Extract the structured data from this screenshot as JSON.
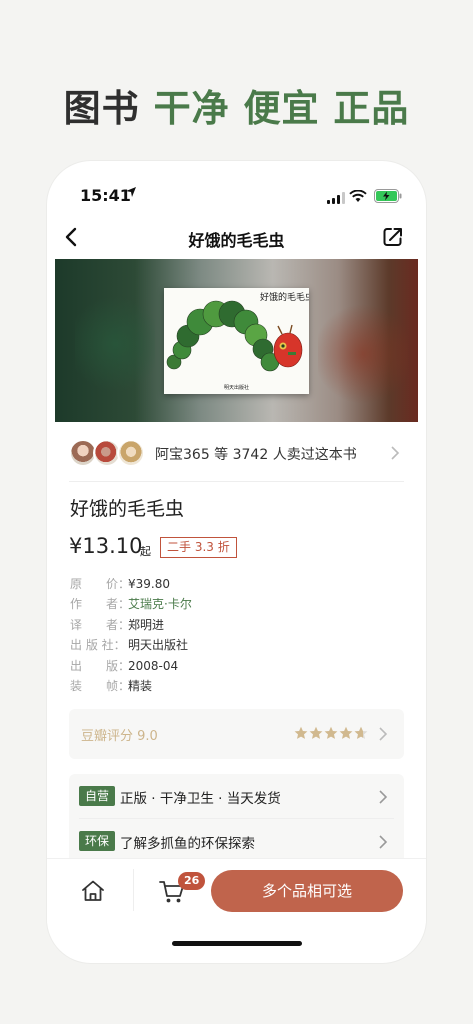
{
  "headline": {
    "part1": "图书",
    "part2": "干净 便宜 正品"
  },
  "status_bar": {
    "time": "15:41"
  },
  "navbar": {
    "title": "好饿的毛毛虫"
  },
  "cover": {
    "title": "好饿的毛毛虫",
    "publisher": "明天出版社"
  },
  "sellers": {
    "text": "阿宝365 等 3742 人卖过这本书"
  },
  "book": {
    "title": "好饿的毛毛虫",
    "price": "¥13.10",
    "price_suffix": "起",
    "discount_badge": "二手 3.3 折"
  },
  "specs": [
    {
      "key": "原　　价：",
      "value": "¥39.80"
    },
    {
      "key": "作　　者：",
      "value": "艾瑞克·卡尔"
    },
    {
      "key": "译　　者：",
      "value": "郑明进"
    },
    {
      "key": "出 版 社：",
      "value": "明天出版社"
    },
    {
      "key": "出　　版：",
      "value": "2008-04"
    },
    {
      "key": "装　　帧：",
      "value": "精装"
    }
  ],
  "douban": {
    "label": "豆瓣评分 9.0",
    "rating": 9.0
  },
  "service": [
    {
      "tag": "自营",
      "text": "正版 · 干净卫生 · 当天发货"
    },
    {
      "tag": "环保",
      "text": "了解多抓鱼的环保探索"
    }
  ],
  "bottom": {
    "cart_count": "26",
    "cta_label": "多个品相可选"
  },
  "colors": {
    "brand_green": "#4a7a4a",
    "accent_red": "#c0533c",
    "cta": "#c0644c",
    "douban_gold": "#cdb58c"
  }
}
